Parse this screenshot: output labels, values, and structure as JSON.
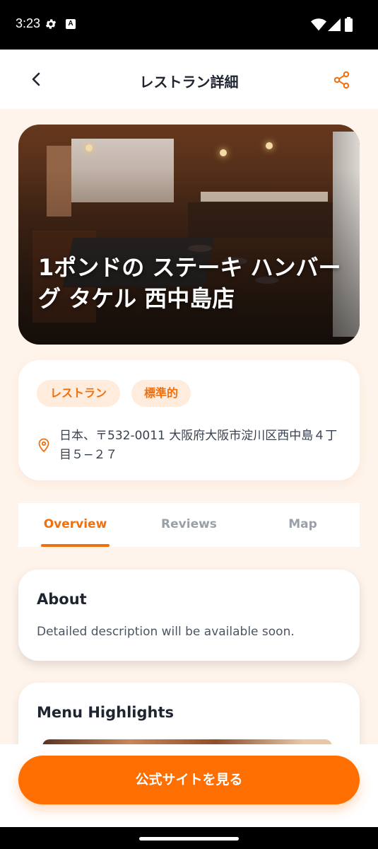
{
  "status_bar": {
    "time": "3:23",
    "icons": [
      "gear-icon",
      "a-notification-icon",
      "wifi-icon",
      "signal-icon",
      "battery-icon"
    ]
  },
  "app_bar": {
    "title": "レストラン詳細",
    "back_icon": "chevron-left-icon",
    "share_icon": "share-icon"
  },
  "restaurant": {
    "name": "1ポンドの ステーキ ハンバーグ タケル 西中島店",
    "chips": [
      "レストラン",
      "標準的"
    ],
    "address": "日本、〒532-0011 大阪府大阪市淀川区西中島４丁目５−２７"
  },
  "tabs": [
    "Overview",
    "Reviews",
    "Map"
  ],
  "active_tab": "Overview",
  "about": {
    "title": "About",
    "text": "Detailed description will be available soon."
  },
  "menu": {
    "title": "Menu Highlights"
  },
  "cta": {
    "label": "公式サイトを見る"
  },
  "colors": {
    "accent": "#FF6E00",
    "background": "#FFF4EB",
    "chip_bg": "#FFECDC"
  }
}
